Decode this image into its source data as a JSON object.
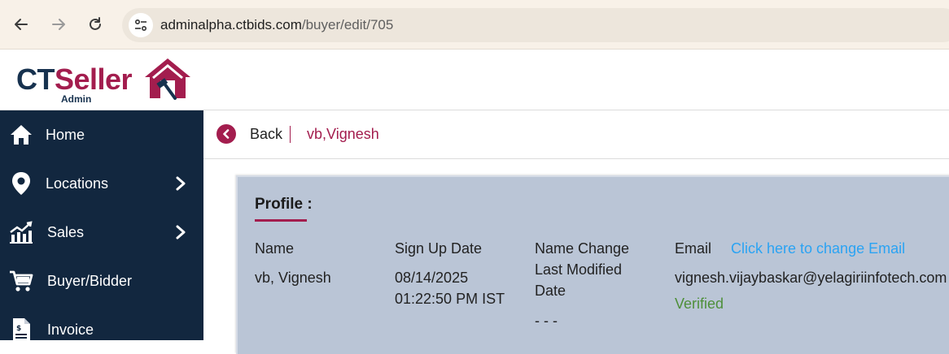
{
  "browser": {
    "url_host": "adminalpha.ctbids.com",
    "url_path": "/buyer/edit/705"
  },
  "logo": {
    "brand_part1": "CT",
    "brand_part2": "Seller",
    "subtitle": "Admin",
    "colors": {
      "navy": "#17324f",
      "maroon": "#a31d4e"
    }
  },
  "sidebar": {
    "items": [
      {
        "label": "Home",
        "icon": "home-icon",
        "has_chevron": false
      },
      {
        "label": "Locations",
        "icon": "location-pin-icon",
        "has_chevron": true
      },
      {
        "label": "Sales",
        "icon": "sales-chart-icon",
        "has_chevron": true
      },
      {
        "label": "Buyer/Bidder",
        "icon": "cart-icon",
        "has_chevron": false
      },
      {
        "label": "Invoice",
        "icon": "invoice-icon",
        "has_chevron": false
      }
    ]
  },
  "header": {
    "back_label": "Back",
    "buyer_name": "vb,Vignesh"
  },
  "profile": {
    "heading": "Profile :",
    "name_label": "Name",
    "name_value": "vb, Vignesh",
    "signup_label": "Sign Up Date",
    "signup_date": "08/14/2025",
    "signup_time": "01:22:50 PM IST",
    "name_change_label_line1": "Name Change",
    "name_change_label_line2": "Last Modified",
    "name_change_label_line3": "Date",
    "name_change_value": "- - -",
    "email_label": "Email",
    "change_email_link": "Click here to change Email",
    "email_value": "vignesh.vijaybaskar@yelagiriinfotech.com",
    "email_status": "Verified"
  },
  "colors": {
    "sidebar_bg": "#12273f",
    "accent": "#a31d4e",
    "panel_bg": "#bac5d6",
    "link": "#2aa3f3",
    "verified": "#4e8f3a"
  }
}
